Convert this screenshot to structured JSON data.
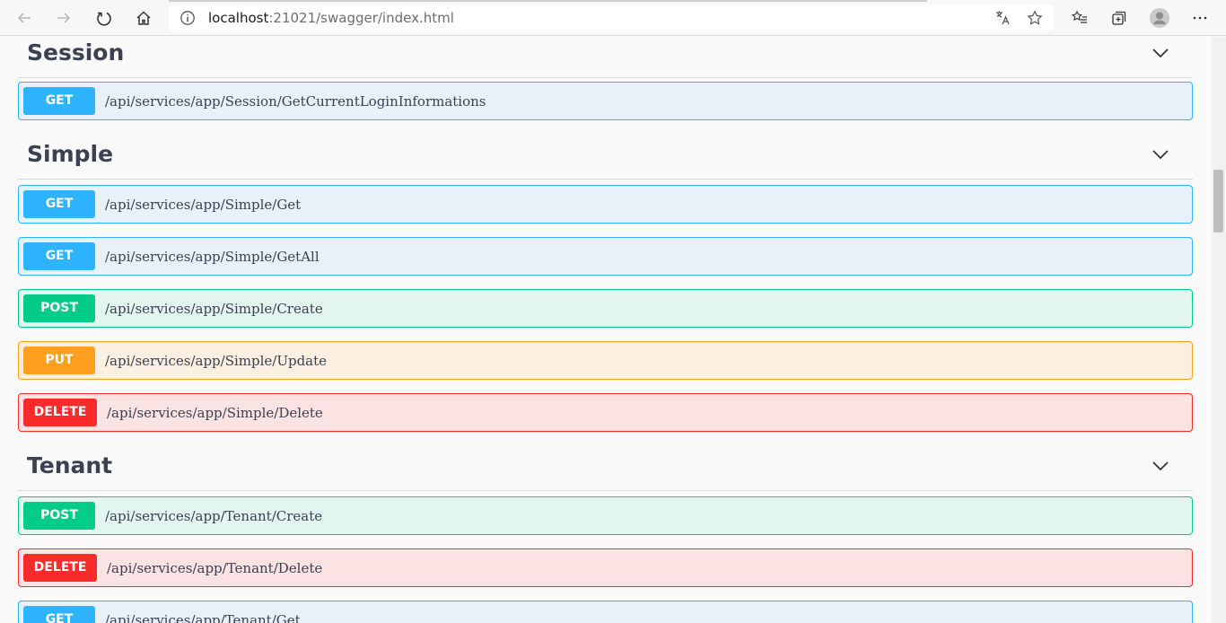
{
  "browser": {
    "url_host": "localhost",
    "url_rest": ":21021/swagger/index.html",
    "icons": [
      "back-icon",
      "forward-icon",
      "refresh-icon",
      "home-icon",
      "info-icon",
      "translate-icon",
      "favorite-star-icon",
      "favorites-list-icon",
      "collections-icon",
      "profile-avatar",
      "more-icon"
    ]
  },
  "colors": {
    "get": "#2eb3ff",
    "get_bg": "#e6f1fa",
    "post": "#03cc88",
    "post_bg": "#e3f5ef",
    "put": "#ff9f1f",
    "put_bg": "#fbefe2",
    "delete": "#f92a2a",
    "delete_bg": "#fbe3e3"
  },
  "sections": [
    {
      "name": "Session",
      "operations": [
        {
          "method": "GET",
          "path": "/api/services/app/Session/GetCurrentLoginInformations"
        }
      ]
    },
    {
      "name": "Simple",
      "operations": [
        {
          "method": "GET",
          "path": "/api/services/app/Simple/Get"
        },
        {
          "method": "GET",
          "path": "/api/services/app/Simple/GetAll"
        },
        {
          "method": "POST",
          "path": "/api/services/app/Simple/Create"
        },
        {
          "method": "PUT",
          "path": "/api/services/app/Simple/Update"
        },
        {
          "method": "DELETE",
          "path": "/api/services/app/Simple/Delete"
        }
      ]
    },
    {
      "name": "Tenant",
      "operations": [
        {
          "method": "POST",
          "path": "/api/services/app/Tenant/Create"
        },
        {
          "method": "DELETE",
          "path": "/api/services/app/Tenant/Delete"
        },
        {
          "method": "GET",
          "path": "/api/services/app/Tenant/Get"
        }
      ]
    }
  ]
}
